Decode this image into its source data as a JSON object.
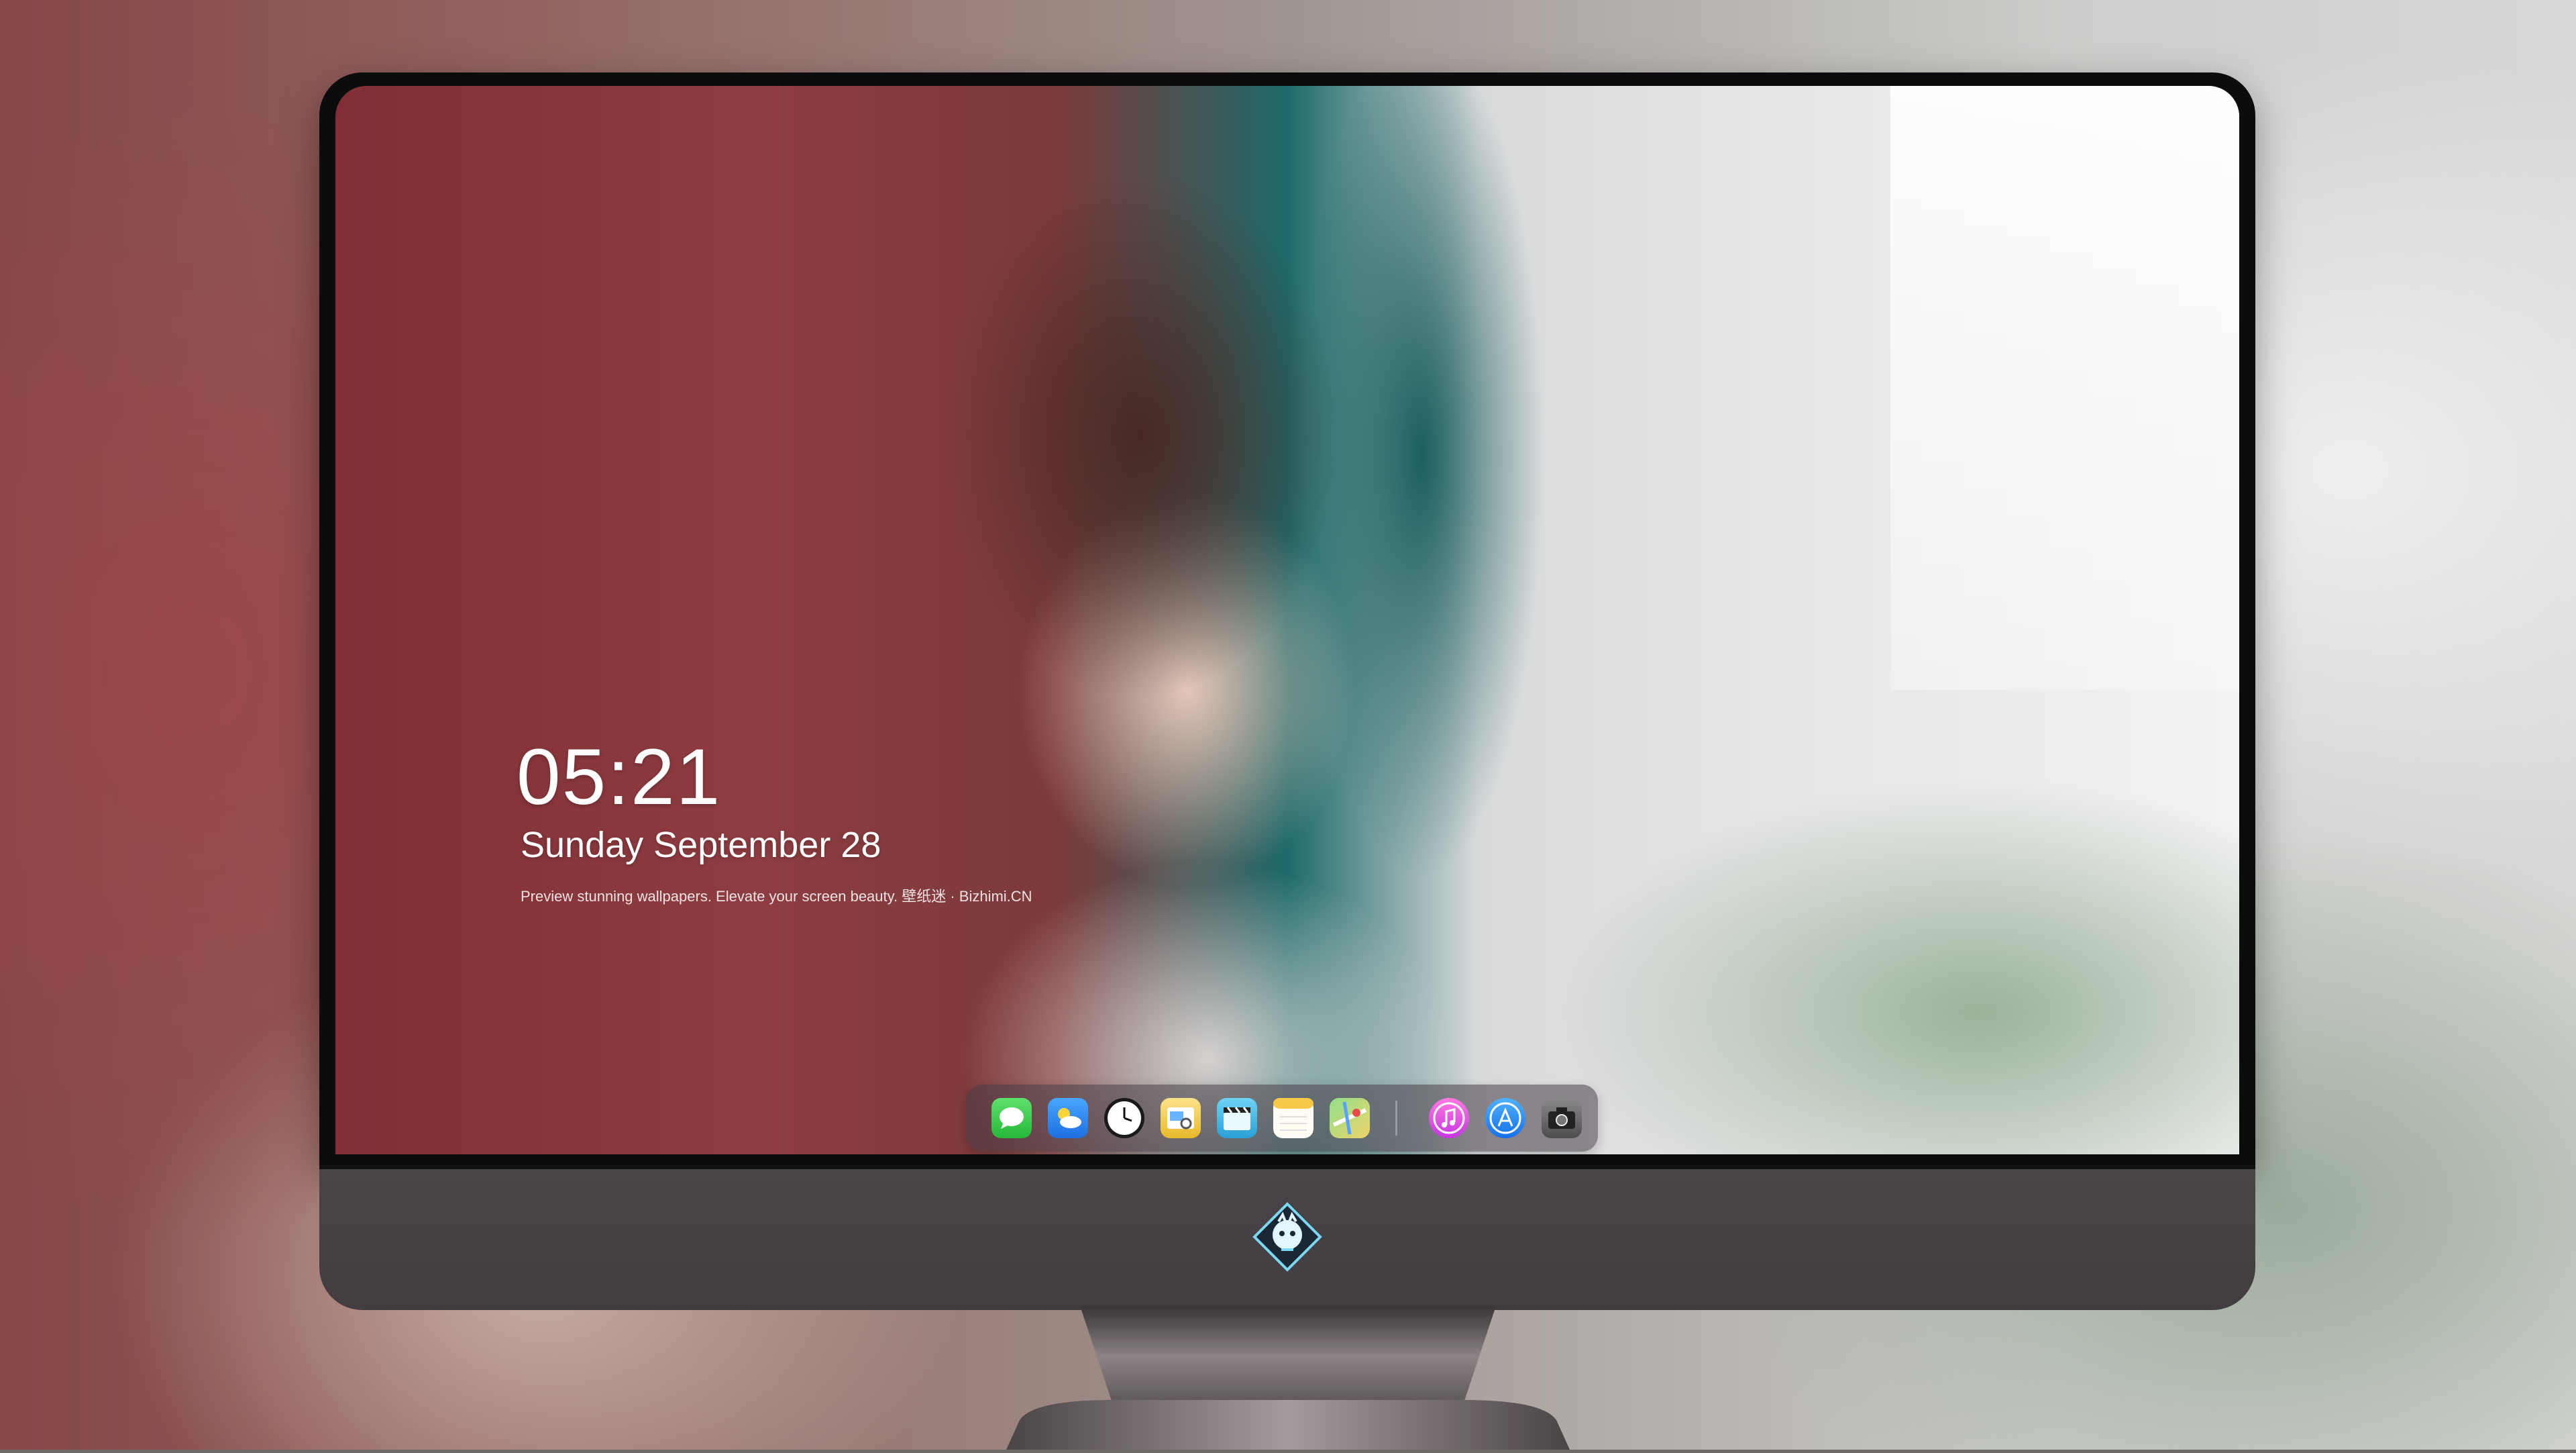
{
  "lockscreen": {
    "time": "05:21",
    "date": "Sunday September  28",
    "caption": "Preview stunning wallpapers. Elevate your screen beauty. 壁纸迷 · Bizhimi.CN"
  },
  "dock": {
    "icons": [
      {
        "name": "messages-icon",
        "color": "#2ecc40"
      },
      {
        "name": "weather-icon",
        "color": "#2d8cf0"
      },
      {
        "name": "clock-icon",
        "color": "#ffffff"
      },
      {
        "name": "preview-icon",
        "color": "#f5c518"
      },
      {
        "name": "clips-icon",
        "color": "#3bb7e8"
      },
      {
        "name": "notes-icon",
        "color": "#f7d55a"
      },
      {
        "name": "maps-icon",
        "color": "#5ac86b"
      },
      {
        "name": "itunes-icon",
        "color": "#e94bd9"
      },
      {
        "name": "app-store-icon",
        "color": "#1a8cff"
      },
      {
        "name": "camera-icon",
        "color": "#5a5a5a"
      }
    ]
  },
  "brand": {
    "logo": "bizhimi-mascot-logo"
  }
}
